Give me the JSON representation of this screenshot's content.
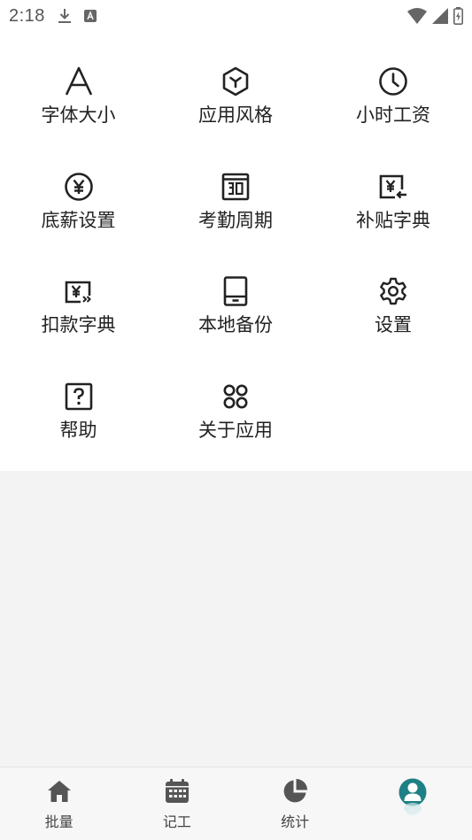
{
  "status_bar": {
    "time": "2:18",
    "icons": [
      "download-icon",
      "text-a-icon",
      "wifi-icon",
      "signal-icon",
      "battery-charging-icon"
    ]
  },
  "menu": {
    "items": [
      {
        "label": "字体大小",
        "icon": "font-a-icon"
      },
      {
        "label": "应用风格",
        "icon": "hexagon-style-icon"
      },
      {
        "label": "小时工资",
        "icon": "clock-icon"
      },
      {
        "label": "底薪设置",
        "icon": "yen-circle-icon"
      },
      {
        "label": "考勤周期",
        "icon": "calendar-30-icon"
      },
      {
        "label": "补贴字典",
        "icon": "yen-arrow-in-icon"
      },
      {
        "label": "扣款字典",
        "icon": "yen-arrow-out-icon"
      },
      {
        "label": "本地备份",
        "icon": "tablet-icon"
      },
      {
        "label": "设置",
        "icon": "gear-icon"
      },
      {
        "label": "帮助",
        "icon": "help-icon"
      },
      {
        "label": "关于应用",
        "icon": "four-circles-icon"
      }
    ]
  },
  "bottom_nav": {
    "items": [
      {
        "label": "批量",
        "icon": "home-icon"
      },
      {
        "label": "记工",
        "icon": "calendar-icon"
      },
      {
        "label": "统计",
        "icon": "pie-chart-icon"
      },
      {
        "label": "",
        "icon": "profile-icon"
      }
    ]
  },
  "colors": {
    "icon": "#222222",
    "profile_icon": "#1f7f86",
    "panel_bg": "#ffffff",
    "page_bg": "#f3f3f3"
  }
}
